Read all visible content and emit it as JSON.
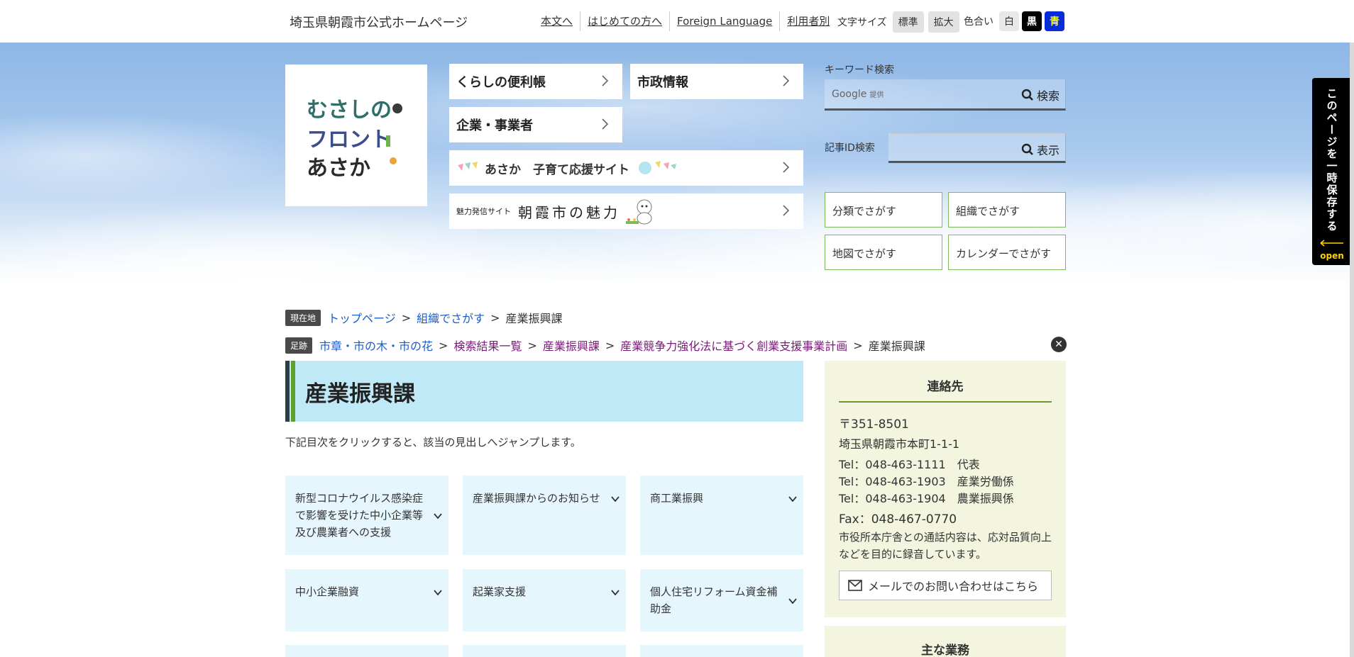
{
  "header": {
    "site_title": "埼玉県朝霞市公式ホームページ",
    "links": [
      "本文へ",
      "はじめての方へ",
      "Foreign Language",
      "利用者別"
    ],
    "font_size_label": "文字サイズ",
    "font_size_options": [
      "標準",
      "拡大"
    ],
    "color_label": "色合い",
    "color_options": [
      "白",
      "黒",
      "青"
    ]
  },
  "logo": {
    "lines": [
      "むさしの",
      "フロント",
      "あさか"
    ]
  },
  "menu": {
    "living": "くらしの便利帳",
    "city": "市政情報",
    "business": "企業・事業者",
    "childcare_banner": "あさか　子育て応援サイト",
    "charm_banner_small": "魅力発信サイト",
    "charm_banner_big": "朝霞市の魅力"
  },
  "search": {
    "keyword_label": "キーワード検索",
    "placeholder_brand": "Google",
    "placeholder_suffix": "提供",
    "search_button": "検索",
    "id_label": "記事ID検索",
    "id_button": "表示"
  },
  "nav_buttons": [
    "分類でさがす",
    "組織でさがす",
    "地図でさがす",
    "カレンダーでさがす"
  ],
  "side_tab": {
    "text": "このページを一時保存する",
    "open": "open"
  },
  "breadcrumb": {
    "current_tag": "現在地",
    "current_links": [
      "トップページ",
      "組織でさがす"
    ],
    "current_page": "産業振興課",
    "history_tag": "足跡",
    "history_links": [
      "市章・市の木・市の花",
      "検索結果一覧",
      "産業振興課",
      "産業競争力強化法に基づく創業支援事業計画"
    ],
    "history_current": "産業振興課"
  },
  "main": {
    "title": "産業振興課",
    "intro": "下記目次をクリックすると、該当の見出しへジャンプします。",
    "toc": [
      "新型コロナウイルス感染症で影響を受けた中小企業等及び農業者への支援",
      "産業振興課からのお知らせ",
      "商工業振興",
      "中小企業融資",
      "起業家支援",
      "個人住宅リフォーム資金補助金"
    ]
  },
  "contact": {
    "heading": "連絡先",
    "postal": "〒351-8501",
    "address": "埼玉県朝霞市本町1-1-1",
    "tel1": "Tel：048-463-1111　代表",
    "tel2": "Tel：048-463-1903　産業労働係",
    "tel3": "Tel：048-463-1904　農業振興係",
    "fax": "Fax：048-467-0770",
    "note": "市役所本庁舎との通話内容は、応対品質向上などを目的に録音しています。",
    "mail_button": "メールでのお問い合わせはこちら"
  },
  "duties": {
    "heading": "主な業務"
  }
}
